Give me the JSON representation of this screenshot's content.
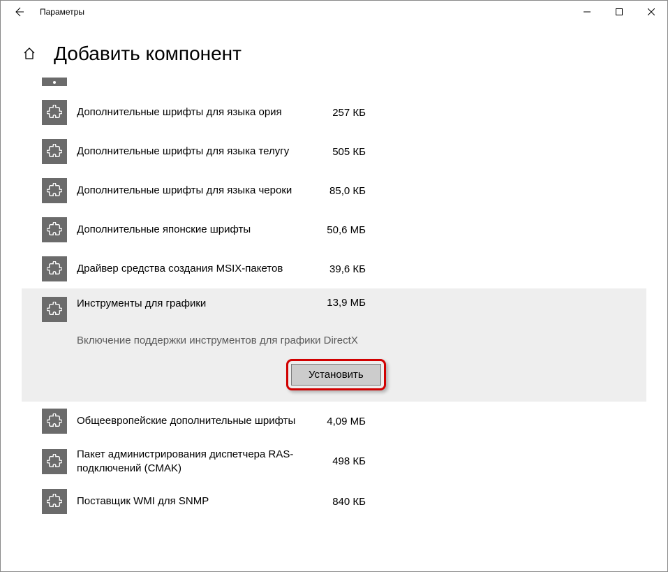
{
  "window": {
    "title": "Параметры"
  },
  "header": {
    "title": "Добавить компонент"
  },
  "items": [
    {
      "name": "Дополнительные шрифты для языка ория",
      "size": "257 КБ"
    },
    {
      "name": "Дополнительные шрифты для языка телугу",
      "size": "505 КБ"
    },
    {
      "name": "Дополнительные шрифты для языка чероки",
      "size": "85,0 КБ"
    },
    {
      "name": "Дополнительные японские шрифты",
      "size": "50,6 МБ"
    },
    {
      "name": "Драйвер средства создания MSIX-пакетов",
      "size": "39,6 КБ"
    },
    {
      "name": "Инструменты для графики",
      "size": "13,9 МБ",
      "description": "Включение поддержки инструментов для графики DirectX",
      "install_label": "Установить"
    },
    {
      "name": "Общеевропейские дополнительные шрифты",
      "size": "4,09 МБ"
    },
    {
      "name": "Пакет администрирования диспетчера RAS-подключений (CMAK)",
      "size": "498 КБ"
    },
    {
      "name": "Поставщик WMI для SNMP",
      "size": "840 КБ"
    }
  ]
}
